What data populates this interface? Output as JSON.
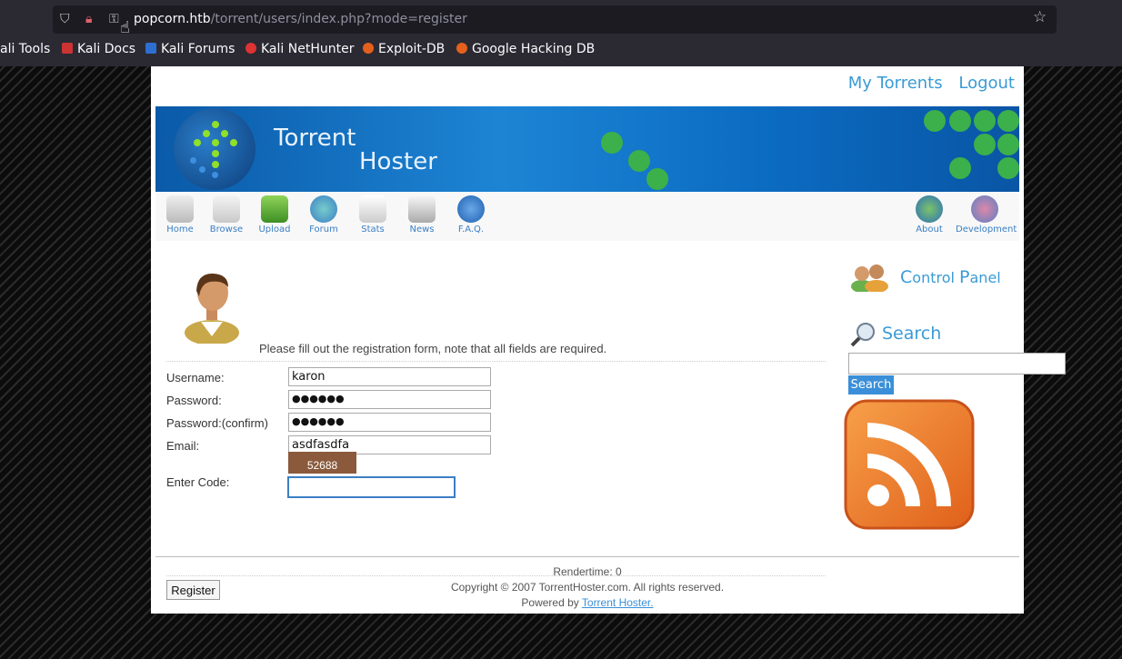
{
  "browser": {
    "url_host": "popcorn.htb",
    "url_path": "/torrent/users/index.php?mode=register",
    "bookmarks": [
      "ali Tools",
      "Kali Docs",
      "Kali Forums",
      "Kali NetHunter",
      "Exploit-DB",
      "Google Hacking DB"
    ]
  },
  "header": {
    "links": [
      "My Torrents",
      "Logout"
    ],
    "brand_line1": "Torrent",
    "brand_line2": "Hoster"
  },
  "nav": {
    "left": [
      "Home",
      "Browse",
      "Upload",
      "Forum",
      "Stats",
      "News",
      "F.A.Q."
    ],
    "right": [
      "About",
      "Development"
    ]
  },
  "form": {
    "intro": "Please fill out the registration form, note that all fields are required.",
    "username_label": "Username:",
    "username_value": "karon",
    "password_label": "Password:",
    "password_value": "●●●●●●",
    "password_confirm_label": "Password:(confirm)",
    "password_confirm_value": "●●●●●●",
    "email_label": "Email:",
    "email_value": "asdfasdfa",
    "code_label": "Enter Code:",
    "captcha_text": "52688",
    "submit_label": "Register"
  },
  "sidebar": {
    "control_panel_c": "C",
    "control_panel_rest1": "ontrol ",
    "control_panel_p": "P",
    "control_panel_rest2": "anel",
    "search_title": "Search",
    "search_button": "Search"
  },
  "footer": {
    "rendertime": "Rendertime: 0",
    "copyright": "Copyright © 2007 TorrentHoster.com. All rights reserved.",
    "powered_prefix": "Powered by ",
    "powered_link": "Torrent Hoster."
  },
  "colors": {
    "accent": "#3a9bd6",
    "banner": "#1d84d4",
    "rss": "#f07a1a"
  }
}
